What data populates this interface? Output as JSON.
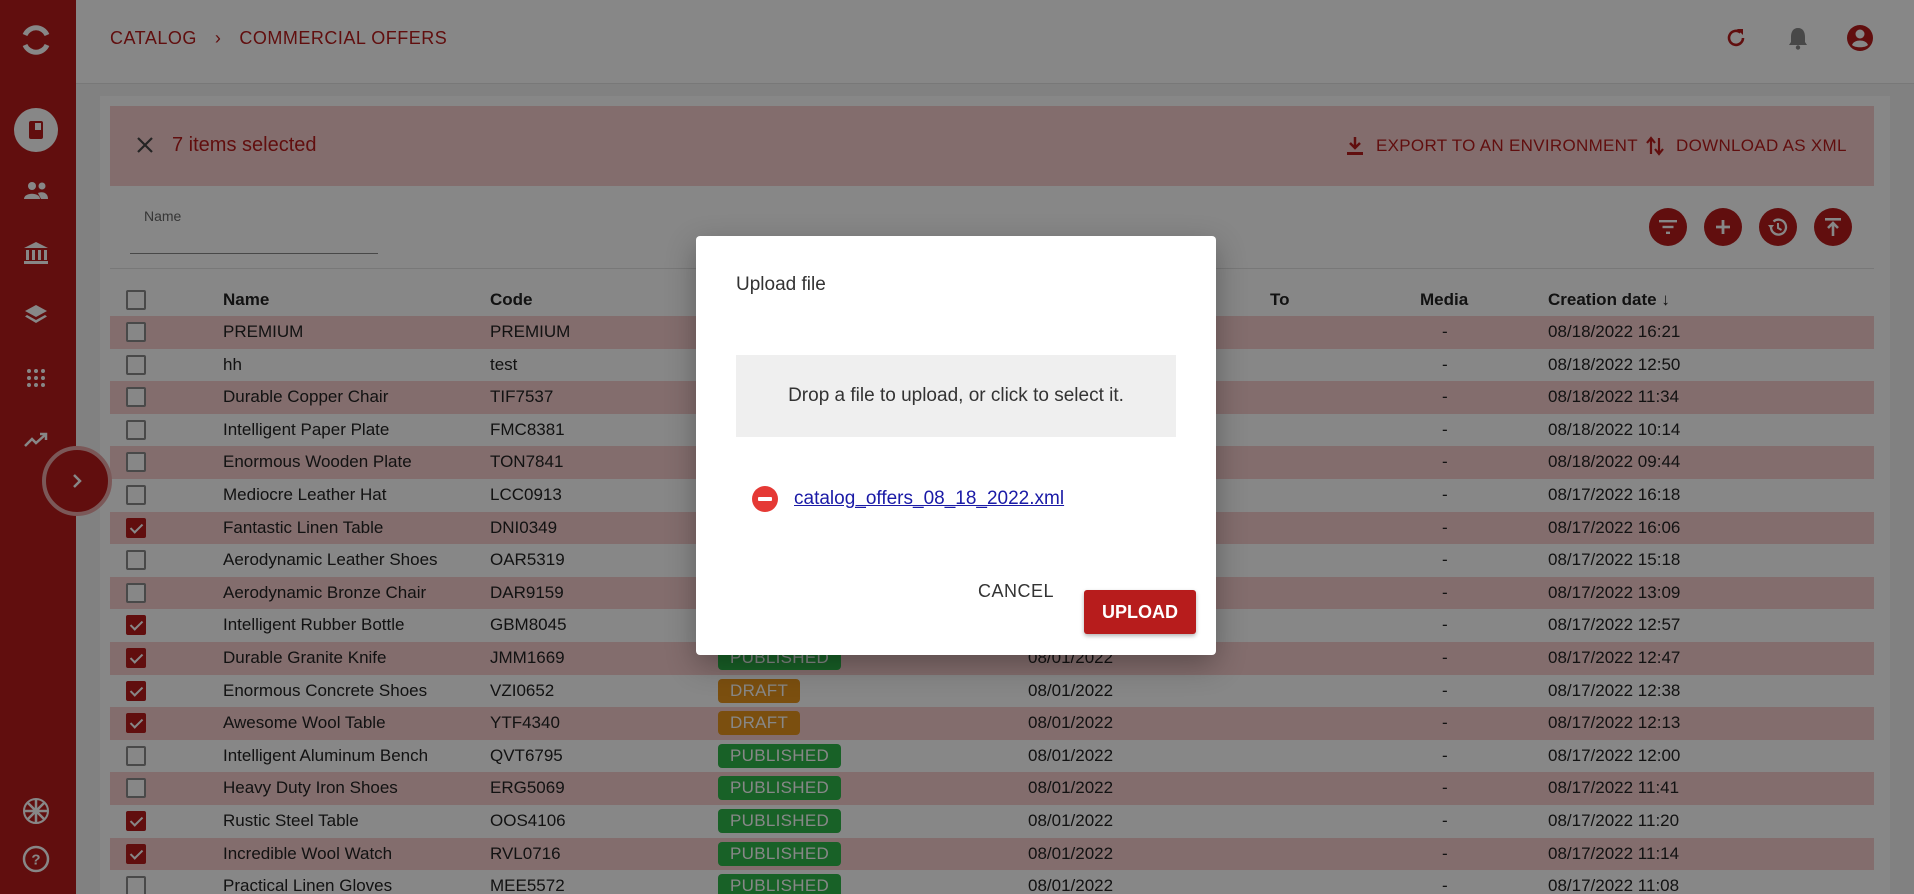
{
  "breadcrumb": {
    "root": "CATALOG",
    "separator": "›",
    "current": "COMMERCIAL OFFERS"
  },
  "selection": {
    "count_text": "7 items selected",
    "export_label": "EXPORT TO AN ENVIRONMENT",
    "download_label": "DOWNLOAD AS XML"
  },
  "filter": {
    "name_label": "Name",
    "name_value": ""
  },
  "table": {
    "headers": {
      "name": "Name",
      "code": "Code",
      "to": "To",
      "media": "Media",
      "creation_date": "Creation date ↓"
    },
    "rows": [
      {
        "checked": false,
        "name": "PREMIUM",
        "code": "PREMIUM",
        "status": "",
        "from": "",
        "media": "-",
        "created": "08/18/2022 16:21"
      },
      {
        "checked": false,
        "name": "hh",
        "code": "test",
        "status": "",
        "from": "",
        "media": "-",
        "created": "08/18/2022 12:50"
      },
      {
        "checked": false,
        "name": "Durable Copper Chair",
        "code": "TIF7537",
        "status": "",
        "from": "",
        "media": "-",
        "created": "08/18/2022 11:34"
      },
      {
        "checked": false,
        "name": "Intelligent Paper Plate",
        "code": "FMC8381",
        "status": "",
        "from": "",
        "media": "-",
        "created": "08/18/2022 10:14"
      },
      {
        "checked": false,
        "name": "Enormous Wooden Plate",
        "code": "TON7841",
        "status": "",
        "from": "",
        "media": "-",
        "created": "08/18/2022 09:44"
      },
      {
        "checked": false,
        "name": "Mediocre Leather Hat",
        "code": "LCC0913",
        "status": "",
        "from": "",
        "media": "-",
        "created": "08/17/2022 16:18"
      },
      {
        "checked": true,
        "name": "Fantastic Linen Table",
        "code": "DNI0349",
        "status": "",
        "from": "",
        "media": "-",
        "created": "08/17/2022 16:06"
      },
      {
        "checked": false,
        "name": "Aerodynamic Leather Shoes",
        "code": "OAR5319",
        "status": "",
        "from": "",
        "media": "-",
        "created": "08/17/2022 15:18"
      },
      {
        "checked": false,
        "name": "Aerodynamic Bronze Chair",
        "code": "DAR9159",
        "status": "",
        "from": "",
        "media": "-",
        "created": "08/17/2022 13:09"
      },
      {
        "checked": true,
        "name": "Intelligent Rubber Bottle",
        "code": "GBM8045",
        "status": "",
        "from": "",
        "media": "-",
        "created": "08/17/2022 12:57"
      },
      {
        "checked": true,
        "name": "Durable Granite Knife",
        "code": "JMM1669",
        "status": "PUBLISHED",
        "from": "08/01/2022",
        "media": "-",
        "created": "08/17/2022 12:47"
      },
      {
        "checked": true,
        "name": "Enormous Concrete Shoes",
        "code": "VZI0652",
        "status": "DRAFT",
        "from": "08/01/2022",
        "media": "-",
        "created": "08/17/2022 12:38"
      },
      {
        "checked": true,
        "name": "Awesome Wool Table",
        "code": "YTF4340",
        "status": "DRAFT",
        "from": "08/01/2022",
        "media": "-",
        "created": "08/17/2022 12:13"
      },
      {
        "checked": false,
        "name": "Intelligent Aluminum Bench",
        "code": "QVT6795",
        "status": "PUBLISHED",
        "from": "08/01/2022",
        "media": "-",
        "created": "08/17/2022 12:00"
      },
      {
        "checked": false,
        "name": "Heavy Duty Iron Shoes",
        "code": "ERG5069",
        "status": "PUBLISHED",
        "from": "08/01/2022",
        "media": "-",
        "created": "08/17/2022 11:41"
      },
      {
        "checked": true,
        "name": "Rustic Steel Table",
        "code": "OOS4106",
        "status": "PUBLISHED",
        "from": "08/01/2022",
        "media": "-",
        "created": "08/17/2022 11:20"
      },
      {
        "checked": true,
        "name": "Incredible Wool Watch",
        "code": "RVL0716",
        "status": "PUBLISHED",
        "from": "08/01/2022",
        "media": "-",
        "created": "08/17/2022 11:14"
      },
      {
        "checked": false,
        "name": "Practical Linen Gloves",
        "code": "MEE5572",
        "status": "PUBLISHED",
        "from": "08/01/2022",
        "media": "-",
        "created": "08/17/2022 11:08"
      }
    ]
  },
  "dialog": {
    "title": "Upload file",
    "dropzone_text": "Drop a file to upload, or click to select it.",
    "file_name": "catalog_offers_08_18_2022.xml",
    "cancel_label": "CANCEL",
    "upload_label": "UPLOAD"
  },
  "colors": {
    "brand": "#b71c1c",
    "row_alt": "#f8cfcf",
    "published": "#2eb84b",
    "draft": "#e9961e"
  },
  "icons": {
    "sidebar": [
      "app-logo-icon",
      "catalog-book-icon",
      "users-icon",
      "bank-icon",
      "layers-icon",
      "grid-dots-icon",
      "trending-icon",
      "uk-flag-icon",
      "help-icon"
    ],
    "topbar": [
      "refresh-icon",
      "bell-icon",
      "account-icon"
    ],
    "tools": [
      "filter-icon",
      "add-icon",
      "history-icon",
      "upload-icon"
    ]
  }
}
